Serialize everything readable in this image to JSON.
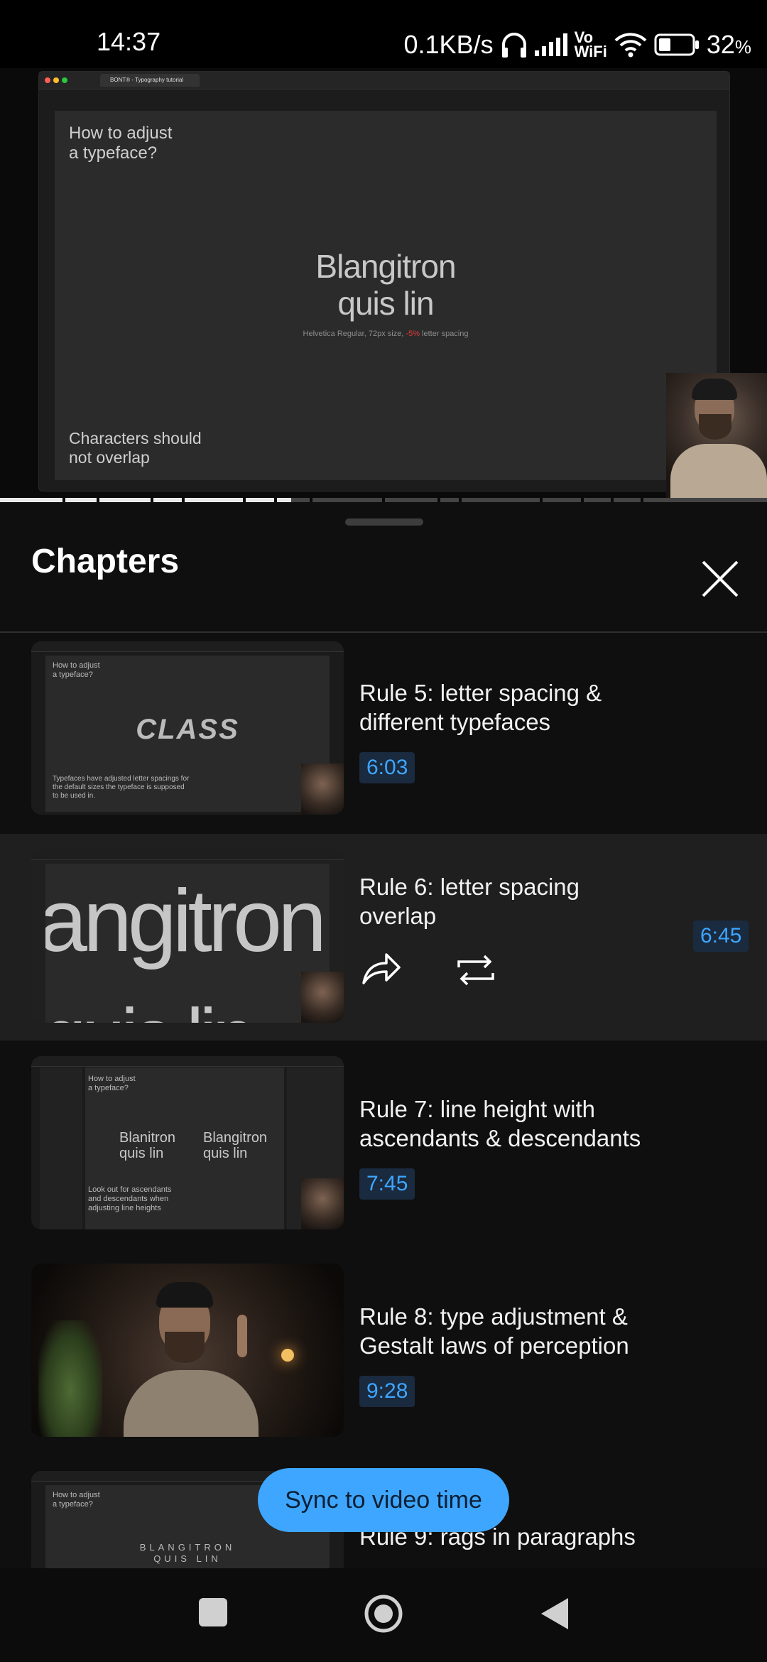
{
  "status_bar": {
    "time": "14:37",
    "network_speed": "0.1KB/s",
    "volte": "Vo",
    "wifi_label": "WiFi",
    "battery": "32",
    "battery_unit": "%"
  },
  "video": {
    "browser_tab": "BONT® - Typography tutorial",
    "slide_question": "How to adjust\na typeface?",
    "slide_sample": "Blangitron\nquis lin",
    "slide_caption_pre": "Helvetica Regular, 72px size, ",
    "slide_caption_accent": "-5%",
    "slide_caption_post": " letter spacing",
    "slide_footer": "Characters should\nnot overlap",
    "progress_fraction": 0.38
  },
  "panel": {
    "title": "Chapters",
    "close_icon": "close-icon"
  },
  "chapters": [
    {
      "title": "Rule 5: letter spacing &\ndifferent typefaces",
      "time": "6:03",
      "thumb_question": "How to adjust\na typeface?",
      "thumb_sample": "CLASS",
      "thumb_footer": "Typefaces have adjusted letter spacings for\nthe default sizes the typeface is supposed\nto be used in."
    },
    {
      "title": "Rule 6: letter spacing\noverlap",
      "time": "6:45",
      "thumb_sample": "angitron",
      "thumb_sample_2": "quis lin",
      "active": true
    },
    {
      "title": "Rule 7: line height with\nascendants & descendants",
      "time": "7:45",
      "thumb_question": "How to adjust\na typeface?",
      "thumb_sample_a": "Blanitron\nquis lin",
      "thumb_sample_b": "Blangitron\nquis lin",
      "thumb_footer": "Look out for ascendants\nand descendants when\nadjusting line heights"
    },
    {
      "title": "Rule 8: type adjustment &\nGestalt laws of perception",
      "time": "9:28"
    },
    {
      "title": "Rule 9: rags in paragraphs",
      "thumb_question": "How to adjust\na typeface?",
      "thumb_sample": "BLANGITRON\nQUIS LIN"
    }
  ],
  "sync_button": "Sync to video time",
  "colors": {
    "accent": "#3ea6ff",
    "time_badge_bg": "#1a2a3f",
    "active_row_bg": "#1f1f1f",
    "caption_red": "#e03a3a"
  }
}
